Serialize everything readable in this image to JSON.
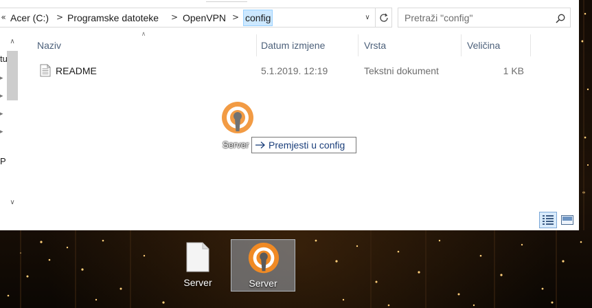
{
  "address_bar": {
    "overflow_glyph": "«",
    "crumbs": [
      "Acer (C:)",
      "Programske datoteke",
      "OpenVPN",
      "config"
    ],
    "separator": ">"
  },
  "search": {
    "placeholder": "Pretraži \"config\""
  },
  "nav_pane": {
    "letters": [
      "tu",
      "P"
    ]
  },
  "columns": {
    "name": "Naziv",
    "date_modified": "Datum izmjene",
    "type": "Vrsta",
    "size": "Veličina"
  },
  "files": [
    {
      "name": "README",
      "date_modified": "5.1.2019. 12:19",
      "type": "Tekstni dokument",
      "size": "1 KB",
      "icon": "text-file-icon"
    }
  ],
  "drag": {
    "item_label": "Server",
    "tooltip": "Premjesti u config",
    "icon": "openvpn-icon"
  },
  "desktop": {
    "icons": [
      {
        "label": "Server",
        "icon": "blank-document-icon",
        "selected": false
      },
      {
        "label": "Server",
        "icon": "openvpn-icon",
        "selected": true
      }
    ]
  },
  "colors": {
    "accent_selection": "#cce8ff",
    "openvpn_orange": "#f08a24",
    "header_text": "#4c607a"
  }
}
